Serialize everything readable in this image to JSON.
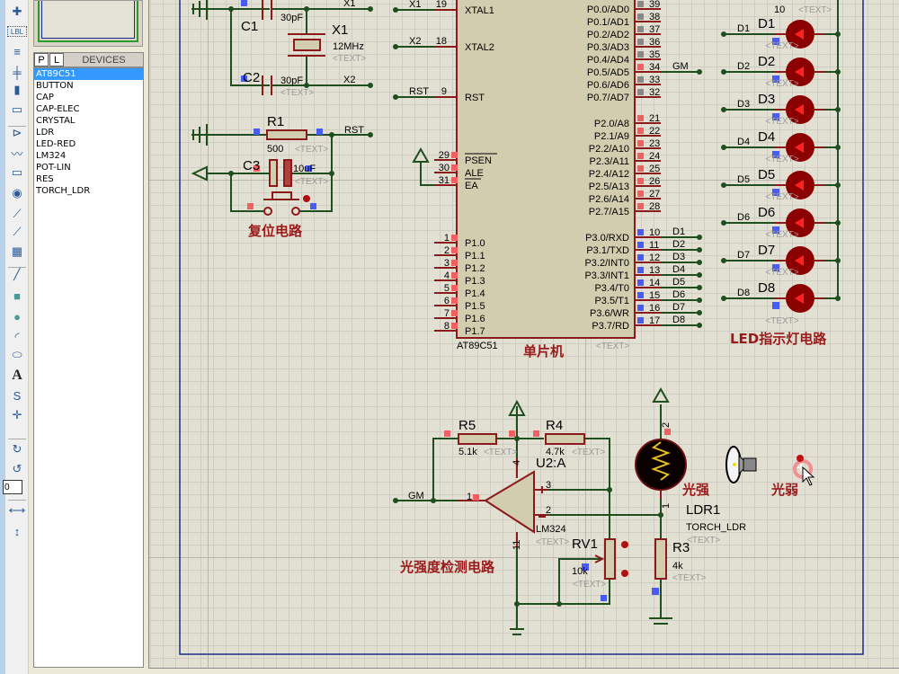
{
  "toolbar": {
    "icons": [
      "junction-dot-icon",
      "wire-label-icon",
      "text-script-icon",
      "bus-icon",
      "subcircuit-icon",
      "terminals-icon",
      "device-pins-icon",
      "graph-icon",
      "tape-recorder-icon",
      "generator-icon",
      "voltage-probe-icon",
      "current-probe-icon",
      "virtual-instrument-icon",
      "line-icon",
      "box-icon",
      "circle-icon",
      "arc-icon",
      "path-icon",
      "text-icon",
      "symbol-icon",
      "marker-icon",
      "rotate-clockwise-icon",
      "rotate-anticlockwise-icon",
      "mirror-horizontal-icon",
      "mirror-vertical-icon"
    ],
    "lbl": "LBL",
    "angle": "0"
  },
  "devices": {
    "p_label": "P",
    "l_label": "L",
    "title": "DEVICES",
    "items": [
      "AT89C51",
      "BUTTON",
      "CAP",
      "CAP-ELEC",
      "CRYSTAL",
      "LDR",
      "LED-RED",
      "LM324",
      "POT-LIN",
      "RES",
      "TORCH_LDR"
    ],
    "selected": "AT89C51"
  },
  "colors": {
    "wire": "#1f4f1f",
    "component": "#8b1a1a",
    "led": "#8b0000",
    "frame": "#1a2a8a",
    "title": "#9a1a1a"
  },
  "placeholder": "<TEXT>",
  "osc": {
    "c1": "C1",
    "c1_val": "30pF",
    "c2": "C2",
    "c2_val": "30pF",
    "x1": "X1",
    "x1_val": "12MHz",
    "net_x1": "X1",
    "net_x2": "X2"
  },
  "reset": {
    "r1": "R1",
    "r1_val": "500",
    "c3": "C3",
    "c3_val": "10uF",
    "net_rst": "RST",
    "title": "复位电路"
  },
  "mcu": {
    "name": "AT89C51",
    "title": "单片机",
    "left_top": [
      {
        "num": "19",
        "label": "XTAL1",
        "net": "X1"
      },
      {
        "num": "18",
        "label": "XTAL2",
        "net": "X2"
      },
      {
        "num": "9",
        "label": "RST",
        "net": "RST"
      },
      {
        "num": "29",
        "label": "PSEN"
      },
      {
        "num": "30",
        "label": "ALE"
      },
      {
        "num": "31",
        "label": "EA"
      }
    ],
    "p1": [
      {
        "num": "1",
        "label": "P1.0"
      },
      {
        "num": "2",
        "label": "P1.1"
      },
      {
        "num": "3",
        "label": "P1.2"
      },
      {
        "num": "4",
        "label": "P1.3"
      },
      {
        "num": "5",
        "label": "P1.4"
      },
      {
        "num": "6",
        "label": "P1.5"
      },
      {
        "num": "7",
        "label": "P1.6"
      },
      {
        "num": "8",
        "label": "P1.7"
      }
    ],
    "p0": [
      {
        "num": "39",
        "label": "P0.0/AD0"
      },
      {
        "num": "38",
        "label": "P0.1/AD1"
      },
      {
        "num": "37",
        "label": "P0.2/AD2"
      },
      {
        "num": "36",
        "label": "P0.3/AD3"
      },
      {
        "num": "35",
        "label": "P0.4/AD4"
      },
      {
        "num": "34",
        "label": "P0.5/AD5",
        "net": "GM"
      },
      {
        "num": "33",
        "label": "P0.6/AD6"
      },
      {
        "num": "32",
        "label": "P0.7/AD7"
      }
    ],
    "p2": [
      {
        "num": "21",
        "label": "P2.0/A8"
      },
      {
        "num": "22",
        "label": "P2.1/A9"
      },
      {
        "num": "23",
        "label": "P2.2/A10"
      },
      {
        "num": "24",
        "label": "P2.3/A11"
      },
      {
        "num": "25",
        "label": "P2.4/A12"
      },
      {
        "num": "26",
        "label": "P2.5/A13"
      },
      {
        "num": "27",
        "label": "P2.6/A14"
      },
      {
        "num": "28",
        "label": "P2.7/A15"
      }
    ],
    "p3": [
      {
        "num": "10",
        "label": "P3.0/RXD",
        "net": "D1"
      },
      {
        "num": "11",
        "label": "P3.1/TXD",
        "net": "D2"
      },
      {
        "num": "12",
        "label": "P3.2/INT0",
        "net": "D3"
      },
      {
        "num": "13",
        "label": "P3.3/INT1",
        "net": "D4"
      },
      {
        "num": "14",
        "label": "P3.4/T0",
        "net": "D5"
      },
      {
        "num": "15",
        "label": "P3.5/T1",
        "net": "D6"
      },
      {
        "num": "16",
        "label": "P3.6/WR",
        "net": "D7"
      },
      {
        "num": "17",
        "label": "P3.7/RD",
        "net": "D8"
      }
    ]
  },
  "leds": {
    "top_value": "10",
    "title": "LED指示灯电路",
    "items": [
      {
        "ref": "D1",
        "net": "D1"
      },
      {
        "ref": "D2",
        "net": "D2"
      },
      {
        "ref": "D3",
        "net": "D3"
      },
      {
        "ref": "D4",
        "net": "D4"
      },
      {
        "ref": "D5",
        "net": "D5"
      },
      {
        "ref": "D6",
        "net": "D6"
      },
      {
        "ref": "D7",
        "net": "D7"
      },
      {
        "ref": "D8",
        "net": "D8"
      }
    ]
  },
  "sensor": {
    "net_gm": "GM",
    "r5": "R5",
    "r5_val": "5.1k",
    "r4": "R4",
    "r4_val": "4.7k",
    "u2": "U2:A",
    "u2_val": "LM324",
    "rv1": "RV1",
    "rv1_val": "10k",
    "pin4": "4",
    "pin3": "3",
    "pin2": "2",
    "pin1": "1",
    "pin11": "11",
    "title": "光强度检测电路",
    "ldr": "LDR1",
    "ldr_val": "TORCH_LDR",
    "r3": "R3",
    "r3_val": "4k",
    "strong": "光强",
    "weak": "光弱",
    "ldr_pin2": "2",
    "ldr_pin1": "1"
  }
}
